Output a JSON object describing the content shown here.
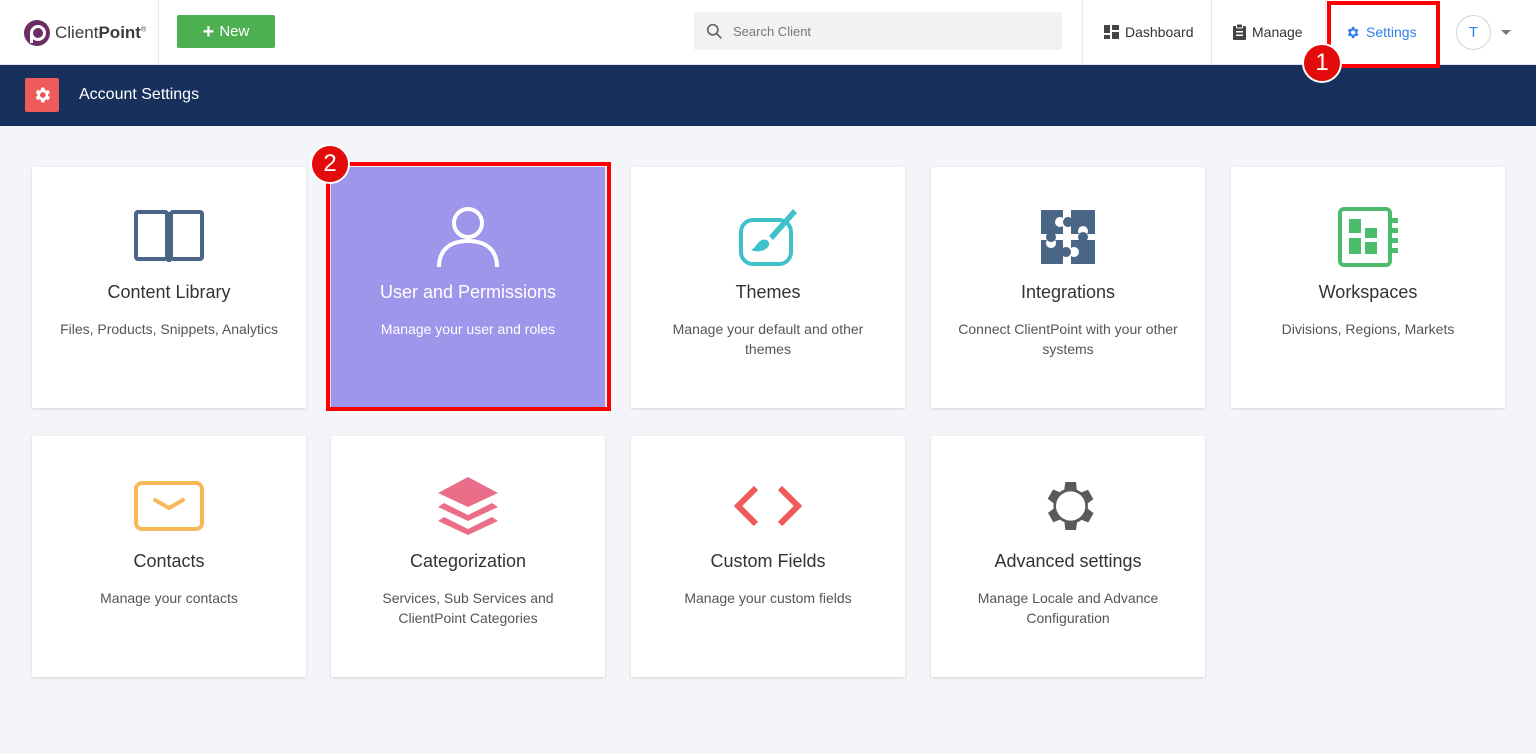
{
  "topbar": {
    "logo_text_regular": "Client",
    "logo_text_bold": "Point",
    "logo_reg": "®",
    "new_button_label": "New",
    "search_placeholder": "Search Client",
    "nav": [
      {
        "label": "Dashboard",
        "icon": "dashboard-icon"
      },
      {
        "label": "Manage",
        "icon": "clipboard-icon"
      },
      {
        "label": "Settings",
        "icon": "gear-icon",
        "active": true
      }
    ],
    "avatar_initial": "T",
    "active_color": "#2f80ed"
  },
  "header": {
    "title": "Account Settings",
    "icon": "gear-icon",
    "background": "#17305c",
    "icon_background": "#ef5b5b"
  },
  "cards": [
    {
      "title": "Content Library",
      "desc": "Files, Products, Snippets, Analytics",
      "icon": "book-icon",
      "color": "#4a6585"
    },
    {
      "title": "User and Permissions",
      "desc": "Manage your user and roles",
      "icon": "user-icon",
      "color": "#ffffff",
      "highlighted": true
    },
    {
      "title": "Themes",
      "desc": "Manage your default and other themes",
      "icon": "palette-icon",
      "color": "#3fc1c9"
    },
    {
      "title": "Integrations",
      "desc": "Connect ClientPoint with your other systems",
      "icon": "puzzle-icon",
      "color": "#4a6585"
    },
    {
      "title": "Workspaces",
      "desc": "Divisions, Regions, Markets",
      "icon": "workspace-icon",
      "color": "#4cbb6c"
    },
    {
      "title": "Contacts",
      "desc": "Manage your contacts",
      "icon": "envelope-icon",
      "color": "#f7b85a"
    },
    {
      "title": "Categorization",
      "desc": "Services, Sub Services and ClientPoint Categories",
      "icon": "layers-icon",
      "color": "#ea6e8a"
    },
    {
      "title": "Custom Fields",
      "desc": "Manage your custom fields",
      "icon": "code-icon",
      "color": "#ef5b5b"
    },
    {
      "title": "Advanced settings",
      "desc": "Manage Locale and Advance Configuration",
      "icon": "cog-icon",
      "color": "#5a5a5a"
    }
  ],
  "annotations": [
    {
      "label": "1",
      "target": "Settings"
    },
    {
      "label": "2",
      "target": "User and Permissions"
    }
  ]
}
